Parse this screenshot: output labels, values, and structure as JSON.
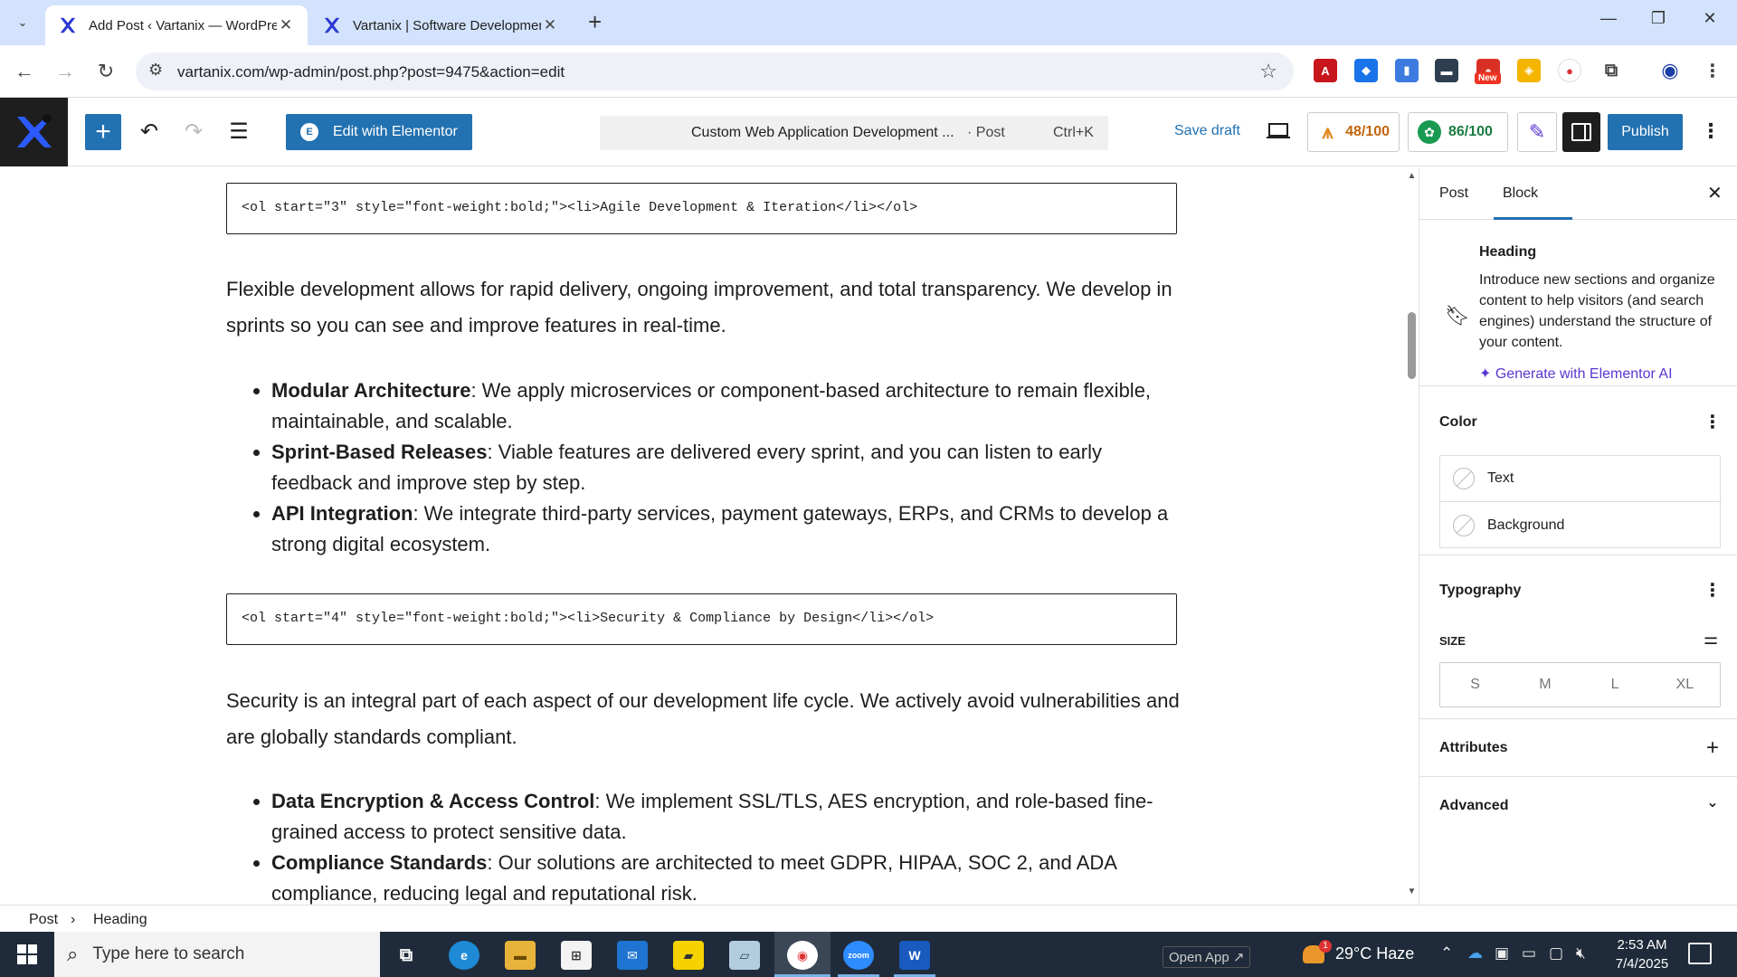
{
  "browser": {
    "tabs": [
      {
        "title": "Add Post ‹ Vartanix — WordPre",
        "active": true
      },
      {
        "title": "Vartanix | Software Developmen",
        "active": false
      }
    ],
    "new_tab_label": "+",
    "url": "vartanix.com/wp-admin/post.php?post=9475&action=edit",
    "new_badge": "New"
  },
  "toolbar": {
    "edit_elementor": "Edit with Elementor",
    "doc_title": "Custom Web Application Development ...",
    "doc_type": "· Post",
    "shortcut": "Ctrl+K",
    "save_draft": "Save draft",
    "score_seo": "48/100",
    "score_read": "86/100",
    "publish": "Publish"
  },
  "content": {
    "code1": "<ol start=\"3\" style=\"font-weight:bold;\"><li>Agile Development & Iteration</li></ol>",
    "para1": "Flexible development allows for rapid delivery, ongoing improvement, and total transparency. We develop in sprints so you can see and improve features in real-time.",
    "list1": [
      {
        "term": "Modular Architecture",
        "text": ": We apply microservices or component-based architecture to remain flexible, maintainable, and scalable."
      },
      {
        "term": "Sprint-Based Releases",
        "text": ": Viable features are delivered every sprint, and you can listen to early feedback and improve step by step."
      },
      {
        "term": "API Integration",
        "text": ": We integrate third-party services, payment gateways, ERPs, and CRMs to develop a strong digital ecosystem."
      }
    ],
    "code2": "<ol start=\"4\" style=\"font-weight:bold;\"><li>Security & Compliance by Design</li></ol>",
    "para2": "Security is an integral part of each aspect of our development life cycle. We actively avoid vulnerabilities and are globally standards compliant.",
    "list2": [
      {
        "term": "Data Encryption & Access Control",
        "text": ": We implement SSL/TLS, AES encryption, and role-based fine-grained access to protect sensitive data."
      },
      {
        "term": "Compliance Standards",
        "text": ": Our solutions are architected to meet GDPR, HIPAA, SOC 2, and ADA compliance, reducing legal and reputational risk."
      }
    ]
  },
  "sidebar": {
    "tab_post": "Post",
    "tab_block": "Block",
    "block_name": "Heading",
    "block_desc": "Introduce new sections and organize content to help visitors (and search engines) understand the structure of your content.",
    "generate_ai": "Generate with Elementor AI",
    "color_title": "Color",
    "color_text": "Text",
    "color_background": "Background",
    "typography_title": "Typography",
    "size_label": "SIZE",
    "sizes": [
      "S",
      "M",
      "L",
      "XL"
    ],
    "attributes_title": "Attributes",
    "advanced_title": "Advanced"
  },
  "breadcrumb": {
    "root": "Post",
    "sep": "›",
    "current": "Heading"
  },
  "taskbar": {
    "search_placeholder": "Type here to search",
    "open_app": "Open App ↗",
    "weather": "29°C  Haze",
    "weather_badge": "1",
    "time": "2:53 AM",
    "date": "7/4/2025"
  },
  "colors": {
    "wp_blue": "#2271b1",
    "elementor_purple": "#5a36d1",
    "taskbar": "#1f2b3a",
    "tabbar": "#d3e3fd"
  }
}
